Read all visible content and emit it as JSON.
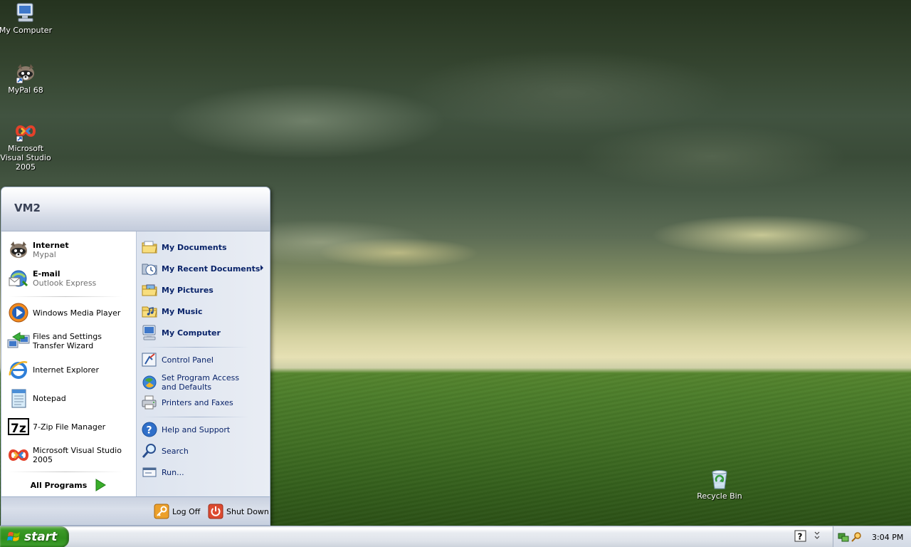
{
  "desktop": {
    "icons": [
      {
        "label": "My Computer",
        "icon": "computer-icon"
      },
      {
        "label": "MyPal 68",
        "icon": "raccoon-icon"
      },
      {
        "label": "Microsoft Visual Studio 2005",
        "icon": "visual-studio-icon"
      },
      {
        "label": "Recycle Bin",
        "icon": "recycle-bin-icon"
      }
    ]
  },
  "start_menu": {
    "user": "VM2",
    "pinned": [
      {
        "title": "Internet",
        "subtitle": "Mypal",
        "icon": "raccoon-icon"
      },
      {
        "title": "E-mail",
        "subtitle": "Outlook Express",
        "icon": "email-icon"
      }
    ],
    "recent": [
      {
        "title": "Windows Media Player",
        "icon": "media-player-icon"
      },
      {
        "title": "Files and Settings Transfer Wizard",
        "icon": "transfer-wizard-icon"
      },
      {
        "title": "Internet Explorer",
        "icon": "internet-explorer-icon"
      },
      {
        "title": "Notepad",
        "icon": "notepad-icon"
      },
      {
        "title": "7-Zip File Manager",
        "icon": "7zip-icon"
      },
      {
        "title": "Microsoft Visual Studio 2005",
        "icon": "visual-studio-icon"
      }
    ],
    "all_programs": "All Programs",
    "places": [
      {
        "label": "My Documents",
        "icon": "folder-icon"
      },
      {
        "label": "My Recent Documents",
        "icon": "recent-documents-icon"
      },
      {
        "label": "My Pictures",
        "icon": "pictures-folder-icon"
      },
      {
        "label": "My Music",
        "icon": "music-folder-icon"
      },
      {
        "label": "My Computer",
        "icon": "computer-icon"
      }
    ],
    "settings": [
      {
        "label": "Control Panel",
        "icon": "control-panel-icon"
      },
      {
        "label": "Set Program Access and Defaults",
        "icon": "program-defaults-icon"
      },
      {
        "label": "Printers and Faxes",
        "icon": "printer-icon"
      }
    ],
    "tools": [
      {
        "label": "Help and Support",
        "icon": "help-icon"
      },
      {
        "label": "Search",
        "icon": "search-icon"
      },
      {
        "label": "Run...",
        "icon": "run-icon"
      }
    ],
    "log_off": "Log Off",
    "shut_down": "Shut Down"
  },
  "taskbar": {
    "start_label": "start",
    "clock": "3:04 PM"
  },
  "colors": {
    "start_green": "#3c9a27",
    "menu_blue_text": "#0a246a",
    "logoff_orange": "#e8a020",
    "shutdown_red": "#d9452c"
  }
}
